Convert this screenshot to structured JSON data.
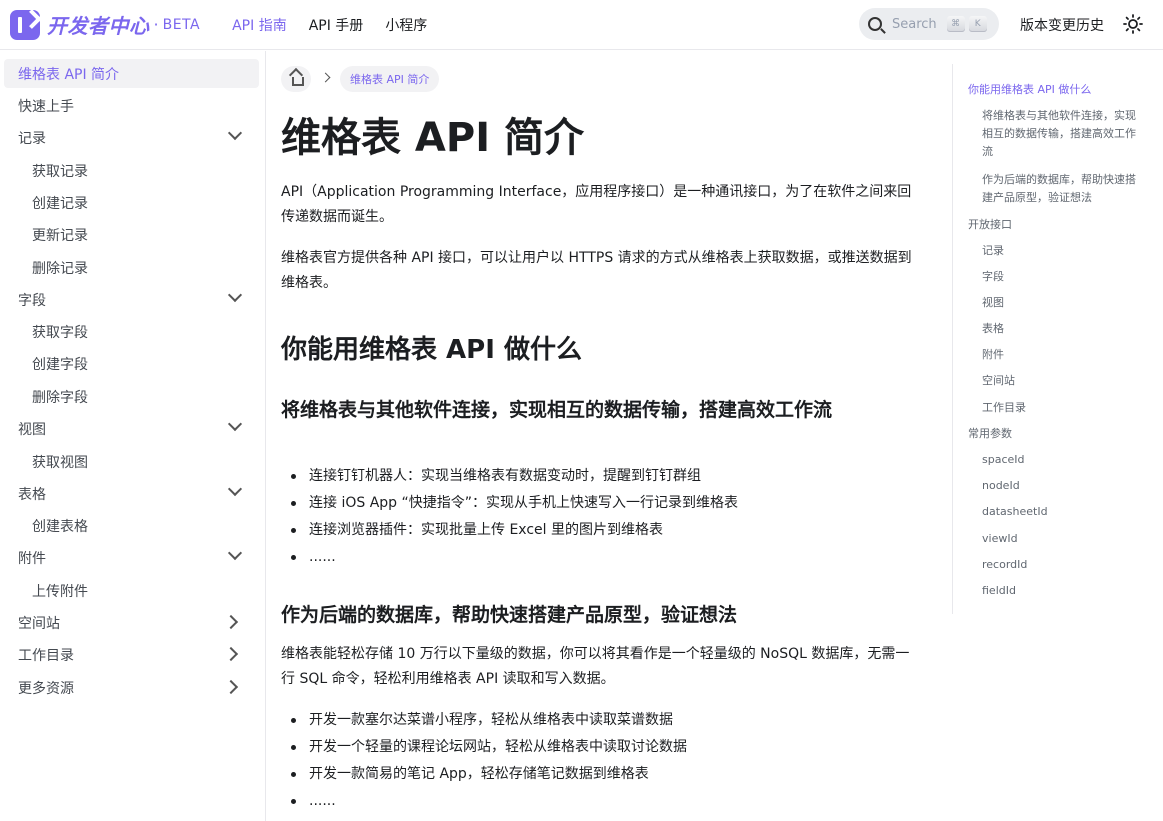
{
  "navbar": {
    "brand_title": "开发者中心",
    "brand_dot": "·",
    "brand_beta": "BETA",
    "links": [
      {
        "label": "API 指南",
        "active": true
      },
      {
        "label": "API 手册",
        "active": false
      },
      {
        "label": "小程序",
        "active": false
      }
    ],
    "search_placeholder": "Search",
    "search_keys": [
      "⌘",
      "K"
    ],
    "changelog": "版本变更历史",
    "accent_color": "#7b67ee"
  },
  "sidebar": {
    "items": [
      {
        "label": "维格表 API 简介",
        "level": 1,
        "active": true,
        "chevron": ""
      },
      {
        "label": "快速上手",
        "level": 1,
        "chevron": ""
      },
      {
        "label": "记录",
        "level": 1,
        "chevron": "down"
      },
      {
        "label": "获取记录",
        "level": 2,
        "chevron": ""
      },
      {
        "label": "创建记录",
        "level": 2,
        "chevron": ""
      },
      {
        "label": "更新记录",
        "level": 2,
        "chevron": ""
      },
      {
        "label": "删除记录",
        "level": 2,
        "chevron": ""
      },
      {
        "label": "字段",
        "level": 1,
        "chevron": "down"
      },
      {
        "label": "获取字段",
        "level": 2,
        "chevron": ""
      },
      {
        "label": "创建字段",
        "level": 2,
        "chevron": ""
      },
      {
        "label": "删除字段",
        "level": 2,
        "chevron": ""
      },
      {
        "label": "视图",
        "level": 1,
        "chevron": "down"
      },
      {
        "label": "获取视图",
        "level": 2,
        "chevron": ""
      },
      {
        "label": "表格",
        "level": 1,
        "chevron": "down"
      },
      {
        "label": "创建表格",
        "level": 2,
        "chevron": ""
      },
      {
        "label": "附件",
        "level": 1,
        "chevron": "down"
      },
      {
        "label": "上传附件",
        "level": 2,
        "chevron": ""
      },
      {
        "label": "空间站",
        "level": 1,
        "chevron": "right"
      },
      {
        "label": "工作目录",
        "level": 1,
        "chevron": "right"
      },
      {
        "label": "更多资源",
        "level": 1,
        "chevron": "right"
      }
    ]
  },
  "main": {
    "breadcrumb_current": "维格表 API 简介",
    "title": "维格表 API 简介",
    "intro_1": "API（Application Programming Interface，应用程序接口）是一种通讯接口，为了在软件之间来回传递数据而诞生。",
    "intro_2": "维格表官方提供各种 API 接口，可以让用户以 HTTPS 请求的方式从维格表上获取数据，或推送数据到维格表。",
    "h2_what": "你能用维格表 API 做什么",
    "h3_connect": "将维格表与其他软件连接，实现相互的数据传输，搭建高效工作流",
    "connect_bullets": [
      "连接钉钉机器人：实现当维格表有数据变动时，提醒到钉钉群组",
      "连接 iOS App “快捷指令”：实现从手机上快速写入一行记录到维格表",
      "连接浏览器插件：实现批量上传 Excel 里的图片到维格表",
      "......"
    ],
    "h3_backend": "作为后端的数据库，帮助快速搭建产品原型，验证想法",
    "backend_para": "维格表能轻松存储 10 万行以下量级的数据，你可以将其看作是一个轻量级的 NoSQL 数据库，无需一行 SQL 命令，轻松利用维格表 API 读取和写入数据。",
    "backend_bullets": [
      "开发一款塞尔达菜谱小程序，轻松从维格表中读取菜谱数据",
      "开发一个轻量的课程论坛网站，轻松从维格表中读取讨论数据",
      "开发一款简易的笔记 App，轻松存储笔记数据到维格表",
      "......"
    ]
  },
  "toc": {
    "items": [
      {
        "label": "你能用维格表 API 做什么",
        "level": 1,
        "active": true
      },
      {
        "label": "将维格表与其他软件连接，实现相互的数据传输，搭建高效工作流",
        "level": 2
      },
      {
        "label": "作为后端的数据库，帮助快速搭建产品原型，验证想法",
        "level": 2
      },
      {
        "label": "开放接口",
        "level": 1
      },
      {
        "label": "记录",
        "level": 2
      },
      {
        "label": "字段",
        "level": 2
      },
      {
        "label": "视图",
        "level": 2
      },
      {
        "label": "表格",
        "level": 2
      },
      {
        "label": "附件",
        "level": 2
      },
      {
        "label": "空间站",
        "level": 2
      },
      {
        "label": "工作目录",
        "level": 2
      },
      {
        "label": "常用参数",
        "level": 1
      },
      {
        "label": "spaceId",
        "level": 2
      },
      {
        "label": "nodeId",
        "level": 2
      },
      {
        "label": "datasheetId",
        "level": 2
      },
      {
        "label": "viewId",
        "level": 2
      },
      {
        "label": "recordId",
        "level": 2
      },
      {
        "label": "fieldId",
        "level": 2
      }
    ]
  }
}
